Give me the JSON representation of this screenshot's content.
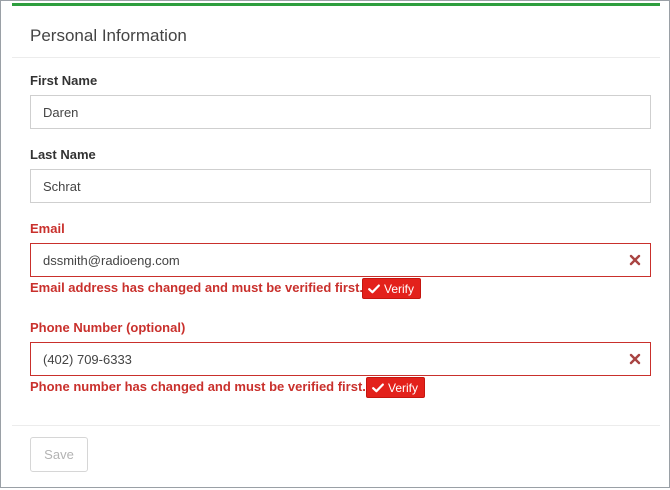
{
  "panel": {
    "title": "Personal Information",
    "accent_color": "#2e9e3e"
  },
  "form": {
    "first_name": {
      "label": "First Name",
      "value": "Daren"
    },
    "last_name": {
      "label": "Last Name",
      "value": "Schrat"
    },
    "email": {
      "label": "Email",
      "value": "dssmith@radioeng.com",
      "error": "Email address has changed and must be verified first.",
      "verify_label": "Verify",
      "clear_icon": "times-icon"
    },
    "phone": {
      "label": "Phone Number (optional)",
      "value": "(402) 709-6333",
      "error": "Phone number has changed and must be verified first.",
      "verify_label": "Verify",
      "clear_icon": "times-icon"
    }
  },
  "footer": {
    "save_label": "Save",
    "save_disabled": true
  },
  "colors": {
    "error": "#c9302c",
    "verify_bg": "#e3211b"
  }
}
